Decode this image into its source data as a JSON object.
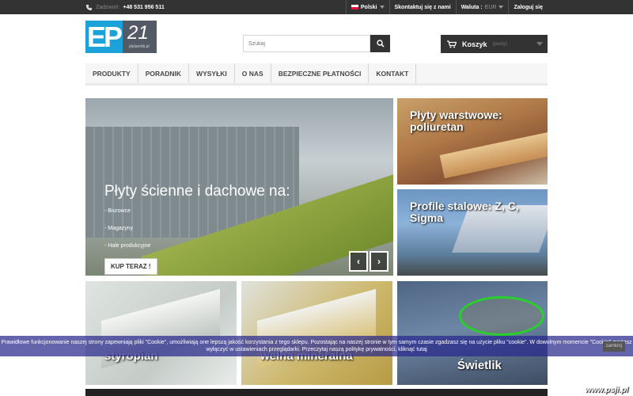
{
  "topbar": {
    "phone_label": "Zadzwoń:",
    "phone_number": "+48 531 956 511",
    "language": "Polski",
    "contact": "Skontaktuj się z nami",
    "currency_label": "Waluta :",
    "currency_value": "EUR",
    "login": "Zaloguj się"
  },
  "logo": {
    "ep": "EP",
    "num": "21",
    "url": "plytaomb.pl"
  },
  "search": {
    "placeholder": "Szukaj"
  },
  "cart": {
    "label": "Koszyk",
    "status": "(pusty)"
  },
  "nav": [
    "PRODUKTY",
    "PORADNIK",
    "WYSYŁKI",
    "O NAS",
    "BEZPIECZNE PŁATNOŚCI",
    "KONTAKT"
  ],
  "slider": {
    "title": "Płyty ścienne i dachowe na:",
    "bullets": [
      "- Biurowce",
      "- Magazyny",
      "- Hale produkcyjne"
    ],
    "button": "KUP TERAZ !"
  },
  "tiles": {
    "t1": "Płyty warstwowe: poliuretan",
    "t2": "Profile stalowe: Z, C, Sigma",
    "t3": "styropian",
    "t4": "wełna mineralna",
    "t5": "Świetlik"
  },
  "cookie": {
    "text": "Prawidłowe funkcjonowanie naszej strony zapewniają pliki \"Cookie\", umożliwiają one lepszą jakość korzystania z tego sklepu. Pozostając na naszej stronie w tym samym czasie zgadzasz się na użycie pliku \"cookie\". W dowolnym momencie \"Cookie\" możesz wyłączyć w ustawieniach przeglądarki. Przeczytaj naszą politykę prywatności, kliknąć tutaj",
    "close": "zamknij"
  },
  "watermark": "www.psji.pl",
  "colors": {
    "accent": "#1ca1d8",
    "dark": "#333333",
    "cookie_bg": "#28288c"
  }
}
